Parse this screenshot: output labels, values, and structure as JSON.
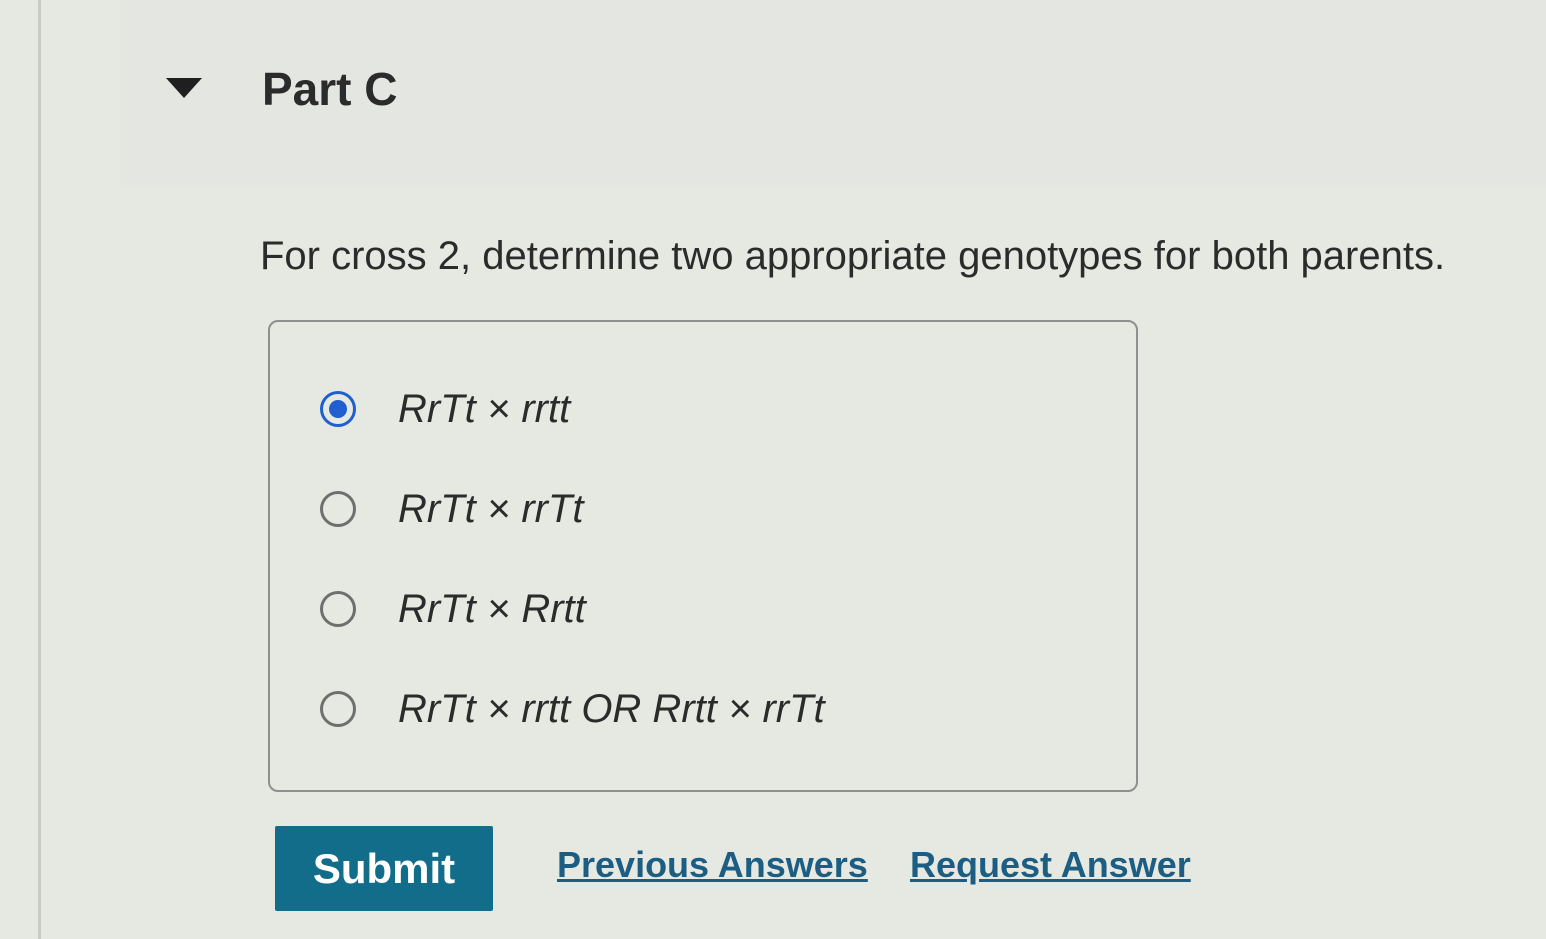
{
  "part": {
    "title": "Part C",
    "toggle_icon": "caret-down-icon"
  },
  "question": {
    "text": "For cross 2, determine two appropriate genotypes for both parents."
  },
  "options": [
    {
      "label": "RrTt × rrtt",
      "selected": true
    },
    {
      "label": "RrTt × rrTt",
      "selected": false
    },
    {
      "label": "RrTt × Rrtt",
      "selected": false
    },
    {
      "label": "RrTt × rrtt OR Rrtt × rrTt",
      "selected": false
    }
  ],
  "actions": {
    "submit_label": "Submit",
    "previous_answers_label": "Previous Answers",
    "request_answer_label": "Request Answer"
  },
  "colors": {
    "submit_background": "#116d8a",
    "link": "#1b5d83",
    "radio_selected": "#1f5fd0"
  }
}
